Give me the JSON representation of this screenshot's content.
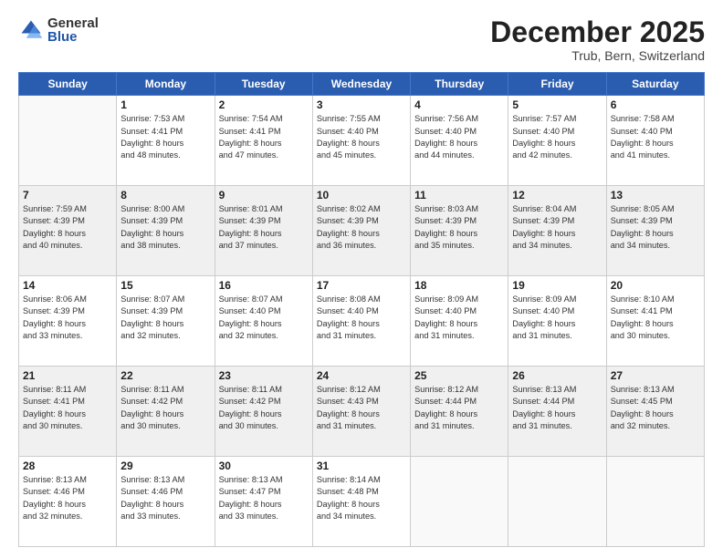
{
  "logo": {
    "general": "General",
    "blue": "Blue"
  },
  "title": "December 2025",
  "location": "Trub, Bern, Switzerland",
  "weekdays": [
    "Sunday",
    "Monday",
    "Tuesday",
    "Wednesday",
    "Thursday",
    "Friday",
    "Saturday"
  ],
  "weeks": [
    [
      {
        "day": "",
        "lines": []
      },
      {
        "day": "1",
        "lines": [
          "Sunrise: 7:53 AM",
          "Sunset: 4:41 PM",
          "Daylight: 8 hours",
          "and 48 minutes."
        ]
      },
      {
        "day": "2",
        "lines": [
          "Sunrise: 7:54 AM",
          "Sunset: 4:41 PM",
          "Daylight: 8 hours",
          "and 47 minutes."
        ]
      },
      {
        "day": "3",
        "lines": [
          "Sunrise: 7:55 AM",
          "Sunset: 4:40 PM",
          "Daylight: 8 hours",
          "and 45 minutes."
        ]
      },
      {
        "day": "4",
        "lines": [
          "Sunrise: 7:56 AM",
          "Sunset: 4:40 PM",
          "Daylight: 8 hours",
          "and 44 minutes."
        ]
      },
      {
        "day": "5",
        "lines": [
          "Sunrise: 7:57 AM",
          "Sunset: 4:40 PM",
          "Daylight: 8 hours",
          "and 42 minutes."
        ]
      },
      {
        "day": "6",
        "lines": [
          "Sunrise: 7:58 AM",
          "Sunset: 4:40 PM",
          "Daylight: 8 hours",
          "and 41 minutes."
        ]
      }
    ],
    [
      {
        "day": "7",
        "lines": [
          "Sunrise: 7:59 AM",
          "Sunset: 4:39 PM",
          "Daylight: 8 hours",
          "and 40 minutes."
        ]
      },
      {
        "day": "8",
        "lines": [
          "Sunrise: 8:00 AM",
          "Sunset: 4:39 PM",
          "Daylight: 8 hours",
          "and 38 minutes."
        ]
      },
      {
        "day": "9",
        "lines": [
          "Sunrise: 8:01 AM",
          "Sunset: 4:39 PM",
          "Daylight: 8 hours",
          "and 37 minutes."
        ]
      },
      {
        "day": "10",
        "lines": [
          "Sunrise: 8:02 AM",
          "Sunset: 4:39 PM",
          "Daylight: 8 hours",
          "and 36 minutes."
        ]
      },
      {
        "day": "11",
        "lines": [
          "Sunrise: 8:03 AM",
          "Sunset: 4:39 PM",
          "Daylight: 8 hours",
          "and 35 minutes."
        ]
      },
      {
        "day": "12",
        "lines": [
          "Sunrise: 8:04 AM",
          "Sunset: 4:39 PM",
          "Daylight: 8 hours",
          "and 34 minutes."
        ]
      },
      {
        "day": "13",
        "lines": [
          "Sunrise: 8:05 AM",
          "Sunset: 4:39 PM",
          "Daylight: 8 hours",
          "and 34 minutes."
        ]
      }
    ],
    [
      {
        "day": "14",
        "lines": [
          "Sunrise: 8:06 AM",
          "Sunset: 4:39 PM",
          "Daylight: 8 hours",
          "and 33 minutes."
        ]
      },
      {
        "day": "15",
        "lines": [
          "Sunrise: 8:07 AM",
          "Sunset: 4:39 PM",
          "Daylight: 8 hours",
          "and 32 minutes."
        ]
      },
      {
        "day": "16",
        "lines": [
          "Sunrise: 8:07 AM",
          "Sunset: 4:40 PM",
          "Daylight: 8 hours",
          "and 32 minutes."
        ]
      },
      {
        "day": "17",
        "lines": [
          "Sunrise: 8:08 AM",
          "Sunset: 4:40 PM",
          "Daylight: 8 hours",
          "and 31 minutes."
        ]
      },
      {
        "day": "18",
        "lines": [
          "Sunrise: 8:09 AM",
          "Sunset: 4:40 PM",
          "Daylight: 8 hours",
          "and 31 minutes."
        ]
      },
      {
        "day": "19",
        "lines": [
          "Sunrise: 8:09 AM",
          "Sunset: 4:40 PM",
          "Daylight: 8 hours",
          "and 31 minutes."
        ]
      },
      {
        "day": "20",
        "lines": [
          "Sunrise: 8:10 AM",
          "Sunset: 4:41 PM",
          "Daylight: 8 hours",
          "and 30 minutes."
        ]
      }
    ],
    [
      {
        "day": "21",
        "lines": [
          "Sunrise: 8:11 AM",
          "Sunset: 4:41 PM",
          "Daylight: 8 hours",
          "and 30 minutes."
        ]
      },
      {
        "day": "22",
        "lines": [
          "Sunrise: 8:11 AM",
          "Sunset: 4:42 PM",
          "Daylight: 8 hours",
          "and 30 minutes."
        ]
      },
      {
        "day": "23",
        "lines": [
          "Sunrise: 8:11 AM",
          "Sunset: 4:42 PM",
          "Daylight: 8 hours",
          "and 30 minutes."
        ]
      },
      {
        "day": "24",
        "lines": [
          "Sunrise: 8:12 AM",
          "Sunset: 4:43 PM",
          "Daylight: 8 hours",
          "and 31 minutes."
        ]
      },
      {
        "day": "25",
        "lines": [
          "Sunrise: 8:12 AM",
          "Sunset: 4:44 PM",
          "Daylight: 8 hours",
          "and 31 minutes."
        ]
      },
      {
        "day": "26",
        "lines": [
          "Sunrise: 8:13 AM",
          "Sunset: 4:44 PM",
          "Daylight: 8 hours",
          "and 31 minutes."
        ]
      },
      {
        "day": "27",
        "lines": [
          "Sunrise: 8:13 AM",
          "Sunset: 4:45 PM",
          "Daylight: 8 hours",
          "and 32 minutes."
        ]
      }
    ],
    [
      {
        "day": "28",
        "lines": [
          "Sunrise: 8:13 AM",
          "Sunset: 4:46 PM",
          "Daylight: 8 hours",
          "and 32 minutes."
        ]
      },
      {
        "day": "29",
        "lines": [
          "Sunrise: 8:13 AM",
          "Sunset: 4:46 PM",
          "Daylight: 8 hours",
          "and 33 minutes."
        ]
      },
      {
        "day": "30",
        "lines": [
          "Sunrise: 8:13 AM",
          "Sunset: 4:47 PM",
          "Daylight: 8 hours",
          "and 33 minutes."
        ]
      },
      {
        "day": "31",
        "lines": [
          "Sunrise: 8:14 AM",
          "Sunset: 4:48 PM",
          "Daylight: 8 hours",
          "and 34 minutes."
        ]
      },
      {
        "day": "",
        "lines": []
      },
      {
        "day": "",
        "lines": []
      },
      {
        "day": "",
        "lines": []
      }
    ]
  ]
}
